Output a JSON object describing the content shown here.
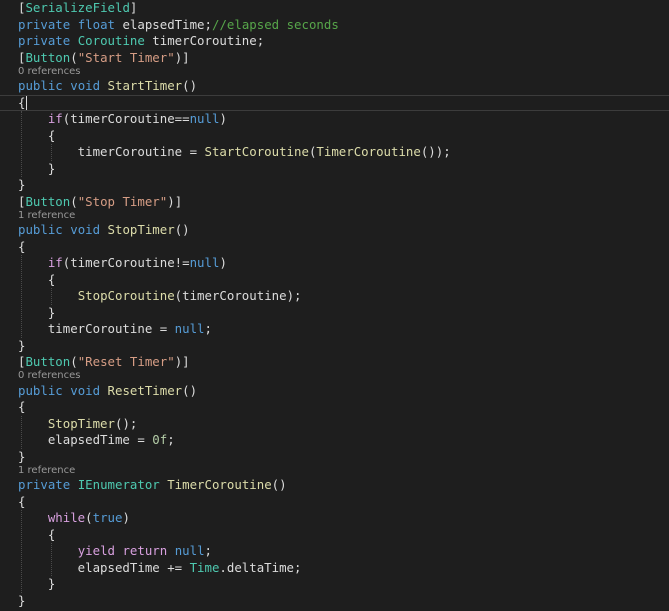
{
  "colors": {
    "background": "#1e1e1e",
    "plain": "#dcdcdc",
    "keyword": "#569cd6",
    "control": "#d8a0df",
    "type": "#4ec9b0",
    "method": "#dcdcaa",
    "string": "#d69d85",
    "comment": "#57a64a",
    "number": "#b5cea8",
    "lens": "#999999"
  },
  "icons": [
    "text-cursor-icon"
  ],
  "lines": [
    {
      "type": "code",
      "tokens": [
        {
          "t": "[",
          "c": "plain"
        },
        {
          "t": "SerializeField",
          "c": "type"
        },
        {
          "t": "]",
          "c": "plain"
        }
      ]
    },
    {
      "type": "code",
      "tokens": [
        {
          "t": "private",
          "c": "keyword"
        },
        {
          "t": " ",
          "c": "plain"
        },
        {
          "t": "float",
          "c": "keyword"
        },
        {
          "t": " elapsedTime;",
          "c": "plain"
        },
        {
          "t": "//elapsed seconds",
          "c": "comment"
        }
      ]
    },
    {
      "type": "code",
      "tokens": [
        {
          "t": "private",
          "c": "keyword"
        },
        {
          "t": " ",
          "c": "plain"
        },
        {
          "t": "Coroutine",
          "c": "type"
        },
        {
          "t": " timerCoroutine;",
          "c": "plain"
        }
      ]
    },
    {
      "type": "code",
      "tokens": [
        {
          "t": "[",
          "c": "plain"
        },
        {
          "t": "Button",
          "c": "type"
        },
        {
          "t": "(",
          "c": "plain"
        },
        {
          "t": "\"Start Timer\"",
          "c": "string"
        },
        {
          "t": ")]",
          "c": "plain"
        }
      ]
    },
    {
      "type": "lens",
      "text": "0 references"
    },
    {
      "type": "code",
      "tokens": [
        {
          "t": "public",
          "c": "keyword"
        },
        {
          "t": " ",
          "c": "plain"
        },
        {
          "t": "void",
          "c": "keyword"
        },
        {
          "t": " ",
          "c": "plain"
        },
        {
          "t": "StartTimer",
          "c": "method"
        },
        {
          "t": "()",
          "c": "plain"
        }
      ]
    },
    {
      "type": "code",
      "current": true,
      "tokens": [
        {
          "t": "{",
          "c": "plain"
        }
      ]
    },
    {
      "type": "code",
      "tokens": [
        {
          "t": "    ",
          "c": "plain"
        },
        {
          "t": "if",
          "c": "control"
        },
        {
          "t": "(timerCoroutine==",
          "c": "plain"
        },
        {
          "t": "null",
          "c": "keyword"
        },
        {
          "t": ")",
          "c": "plain"
        }
      ]
    },
    {
      "type": "code",
      "tokens": [
        {
          "t": "    {",
          "c": "plain"
        }
      ]
    },
    {
      "type": "code",
      "tokens": [
        {
          "t": "        timerCoroutine = ",
          "c": "plain"
        },
        {
          "t": "StartCoroutine",
          "c": "method"
        },
        {
          "t": "(",
          "c": "plain"
        },
        {
          "t": "TimerCoroutine",
          "c": "method"
        },
        {
          "t": "());",
          "c": "plain"
        }
      ]
    },
    {
      "type": "code",
      "tokens": [
        {
          "t": "    }",
          "c": "plain"
        }
      ]
    },
    {
      "type": "code",
      "tokens": [
        {
          "t": "}",
          "c": "plain"
        }
      ]
    },
    {
      "type": "code",
      "tokens": [
        {
          "t": "[",
          "c": "plain"
        },
        {
          "t": "Button",
          "c": "type"
        },
        {
          "t": "(",
          "c": "plain"
        },
        {
          "t": "\"Stop Timer\"",
          "c": "string"
        },
        {
          "t": ")]",
          "c": "plain"
        }
      ]
    },
    {
      "type": "lens",
      "text": "1 reference"
    },
    {
      "type": "code",
      "tokens": [
        {
          "t": "public",
          "c": "keyword"
        },
        {
          "t": " ",
          "c": "plain"
        },
        {
          "t": "void",
          "c": "keyword"
        },
        {
          "t": " ",
          "c": "plain"
        },
        {
          "t": "StopTimer",
          "c": "method"
        },
        {
          "t": "()",
          "c": "plain"
        }
      ]
    },
    {
      "type": "code",
      "tokens": [
        {
          "t": "{",
          "c": "plain"
        }
      ]
    },
    {
      "type": "code",
      "tokens": [
        {
          "t": "    ",
          "c": "plain"
        },
        {
          "t": "if",
          "c": "control"
        },
        {
          "t": "(timerCoroutine!=",
          "c": "plain"
        },
        {
          "t": "null",
          "c": "keyword"
        },
        {
          "t": ")",
          "c": "plain"
        }
      ]
    },
    {
      "type": "code",
      "tokens": [
        {
          "t": "    {",
          "c": "plain"
        }
      ]
    },
    {
      "type": "code",
      "tokens": [
        {
          "t": "        ",
          "c": "plain"
        },
        {
          "t": "StopCoroutine",
          "c": "method"
        },
        {
          "t": "(timerCoroutine);",
          "c": "plain"
        }
      ]
    },
    {
      "type": "code",
      "tokens": [
        {
          "t": "    }",
          "c": "plain"
        }
      ]
    },
    {
      "type": "code",
      "tokens": [
        {
          "t": "    timerCoroutine = ",
          "c": "plain"
        },
        {
          "t": "null",
          "c": "keyword"
        },
        {
          "t": ";",
          "c": "plain"
        }
      ]
    },
    {
      "type": "code",
      "tokens": [
        {
          "t": "}",
          "c": "plain"
        }
      ]
    },
    {
      "type": "code",
      "tokens": [
        {
          "t": "[",
          "c": "plain"
        },
        {
          "t": "Button",
          "c": "type"
        },
        {
          "t": "(",
          "c": "plain"
        },
        {
          "t": "\"Reset Timer\"",
          "c": "string"
        },
        {
          "t": ")]",
          "c": "plain"
        }
      ]
    },
    {
      "type": "lens",
      "text": "0 references"
    },
    {
      "type": "code",
      "tokens": [
        {
          "t": "public",
          "c": "keyword"
        },
        {
          "t": " ",
          "c": "plain"
        },
        {
          "t": "void",
          "c": "keyword"
        },
        {
          "t": " ",
          "c": "plain"
        },
        {
          "t": "ResetTimer",
          "c": "method"
        },
        {
          "t": "()",
          "c": "plain"
        }
      ]
    },
    {
      "type": "code",
      "tokens": [
        {
          "t": "{",
          "c": "plain"
        }
      ]
    },
    {
      "type": "code",
      "tokens": [
        {
          "t": "    ",
          "c": "plain"
        },
        {
          "t": "StopTimer",
          "c": "method"
        },
        {
          "t": "();",
          "c": "plain"
        }
      ]
    },
    {
      "type": "code",
      "tokens": [
        {
          "t": "    elapsedTime = ",
          "c": "plain"
        },
        {
          "t": "0f",
          "c": "number"
        },
        {
          "t": ";",
          "c": "plain"
        }
      ]
    },
    {
      "type": "code",
      "tokens": [
        {
          "t": "}",
          "c": "plain"
        }
      ]
    },
    {
      "type": "lens",
      "text": "1 reference"
    },
    {
      "type": "code",
      "tokens": [
        {
          "t": "private",
          "c": "keyword"
        },
        {
          "t": " ",
          "c": "plain"
        },
        {
          "t": "IEnumerator",
          "c": "type"
        },
        {
          "t": " ",
          "c": "plain"
        },
        {
          "t": "TimerCoroutine",
          "c": "method"
        },
        {
          "t": "()",
          "c": "plain"
        }
      ]
    },
    {
      "type": "code",
      "tokens": [
        {
          "t": "{",
          "c": "plain"
        }
      ]
    },
    {
      "type": "code",
      "tokens": [
        {
          "t": "    ",
          "c": "plain"
        },
        {
          "t": "while",
          "c": "control"
        },
        {
          "t": "(",
          "c": "plain"
        },
        {
          "t": "true",
          "c": "keyword"
        },
        {
          "t": ")",
          "c": "plain"
        }
      ]
    },
    {
      "type": "code",
      "tokens": [
        {
          "t": "    {",
          "c": "plain"
        }
      ]
    },
    {
      "type": "code",
      "tokens": [
        {
          "t": "        ",
          "c": "plain"
        },
        {
          "t": "yield",
          "c": "control"
        },
        {
          "t": " ",
          "c": "plain"
        },
        {
          "t": "return",
          "c": "control"
        },
        {
          "t": " ",
          "c": "plain"
        },
        {
          "t": "null",
          "c": "keyword"
        },
        {
          "t": ";",
          "c": "plain"
        }
      ]
    },
    {
      "type": "code",
      "tokens": [
        {
          "t": "        elapsedTime += ",
          "c": "plain"
        },
        {
          "t": "Time",
          "c": "type"
        },
        {
          "t": ".deltaTime;",
          "c": "plain"
        }
      ]
    },
    {
      "type": "code",
      "tokens": [
        {
          "t": "    }",
          "c": "plain"
        }
      ]
    },
    {
      "type": "code",
      "tokens": [
        {
          "t": "}",
          "c": "plain"
        }
      ]
    }
  ]
}
